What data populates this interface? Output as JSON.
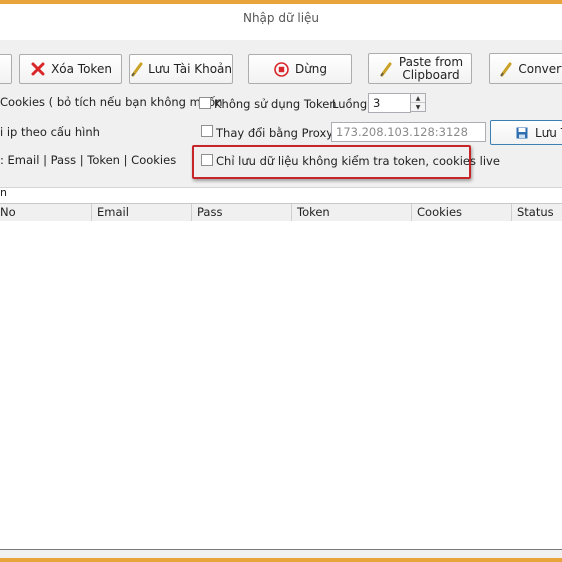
{
  "window": {
    "title": "Nhập dữ liệu"
  },
  "toolbar": {
    "delete_token_label": "Xóa Token",
    "save_account_label": "Lưu Tài Khoản",
    "stop_label": "Dừng",
    "paste_label_line1": "Paste from",
    "paste_label_line2": "Clipboard",
    "convert_label": "Convert C"
  },
  "options": {
    "cookies_note": "Cookies ( bỏ tích nếu bạn không muốn",
    "no_token_label": "Không sử dụng Token",
    "threads_label": "Luồng",
    "threads_value": "3",
    "ip_note": "i ip theo cấu hình",
    "change_proxy_label": "Thay đổi bằng Proxy",
    "proxy_placeholder": "173.208.103.128:3128",
    "save_button_label": "Lưu Ta",
    "format_note": ": Email | Pass | Token | Cookies",
    "only_save_label": "Chỉ lưu dữ liệu không kiểm tra token, cookies live"
  },
  "section_label": "n",
  "table": {
    "columns": [
      "No",
      "Email",
      "Pass",
      "Token",
      "Cookies",
      "Status"
    ],
    "rows": []
  },
  "colors": {
    "frame_accent": "#e8a33b",
    "highlight_border": "#c6262a",
    "delete_icon": "#d9262a",
    "stop_icon": "#d9262a",
    "save_icon": "#2f6fb0"
  }
}
